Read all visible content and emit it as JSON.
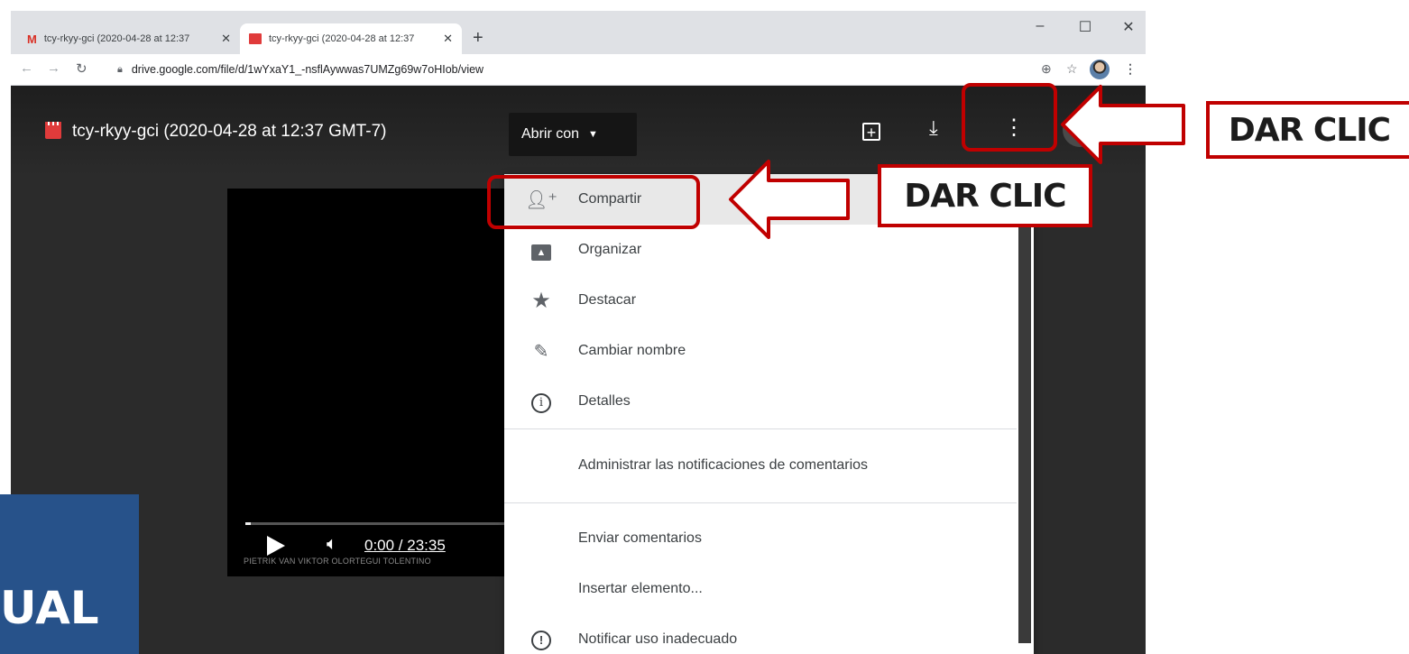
{
  "browser": {
    "tabs": [
      {
        "label": "tcy-rkyy-gci (2020-04-28 at 12:37",
        "icon": "gmail-icon"
      },
      {
        "label": "tcy-rkyy-gci (2020-04-28 at 12:37",
        "icon": "video-file-icon"
      }
    ],
    "new_tab": "+",
    "window_controls": {
      "minimize": "–",
      "maximize": "☐",
      "close": "✕"
    },
    "url": "drive.google.com/file/d/1wYxaY1_-nsflAywwas7UMZg69w7oHIob/view"
  },
  "viewer": {
    "file_title": "tcy-rkyy-gci (2020-04-28 at 12:37 GMT-7)",
    "open_with": "Abrir con",
    "video": {
      "time": "0:00 / 23:35",
      "watermark": "PIETRIK VAN VIKTOR OLORTEGUI TOLENTINO",
      "progress": 0
    }
  },
  "menu": {
    "items": [
      {
        "label": "Compartir",
        "icon": "add-person-icon"
      },
      {
        "label": "Organizar",
        "icon": "drive-folder-icon"
      },
      {
        "label": "Destacar",
        "icon": "star-icon"
      },
      {
        "label": "Cambiar nombre",
        "icon": "pencil-icon"
      },
      {
        "label": "Detalles",
        "icon": "info-icon"
      },
      {
        "label": "Administrar las notificaciones de comentarios",
        "icon": ""
      },
      {
        "label": "Enviar comentarios",
        "icon": ""
      },
      {
        "label": "Insertar elemento...",
        "icon": ""
      },
      {
        "label": "Notificar uso inadecuado",
        "icon": "alert-icon"
      }
    ]
  },
  "annotations": {
    "callout_right": "DAR CLIC",
    "callout_menu": "DAR CLIC",
    "color": "#c00000"
  },
  "logo": {
    "text": "UAL",
    "color": "#27528a"
  }
}
